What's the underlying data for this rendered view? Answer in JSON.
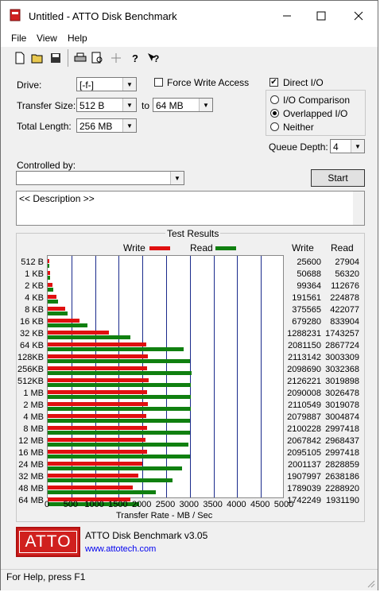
{
  "window": {
    "title": "Untitled - ATTO Disk Benchmark"
  },
  "menu": [
    "File",
    "View",
    "Help"
  ],
  "toolbar_icons": [
    "new-icon",
    "open-icon",
    "save-icon",
    "print-icon",
    "print-preview-icon",
    "move-icon",
    "help-icon",
    "context-help-icon"
  ],
  "settings": {
    "drive_label": "Drive:",
    "drive_value": "[-f-]",
    "force_write_label": "Force Write Access",
    "direct_io_label": "Direct I/O",
    "transfer_size_label": "Transfer Size:",
    "transfer_from": "512 B",
    "to_label": "to",
    "transfer_to": "64 MB",
    "total_length_label": "Total Length:",
    "total_length_value": "256 MB",
    "io_comparison_label": "I/O Comparison",
    "overlapped_io_label": "Overlapped I/O",
    "neither_label": "Neither",
    "queue_depth_label": "Queue Depth:",
    "queue_depth_value": "4",
    "controlled_by_label": "Controlled by:",
    "controlled_by_value": "",
    "start_label": "Start",
    "description": "<< Description >>"
  },
  "results": {
    "header": "Test Results",
    "write_legend": "Write",
    "read_legend": "Read",
    "write_col": "Write",
    "read_col": "Read",
    "x_axis_label": "Transfer Rate - MB / Sec",
    "x_ticks": [
      "0",
      "500",
      "1000",
      "1500",
      "2000",
      "2500",
      "3000",
      "3500",
      "4000",
      "4500",
      "5000"
    ]
  },
  "chart_data": {
    "type": "bar",
    "orientation": "horizontal",
    "xlabel": "Transfer Rate - MB / Sec",
    "xlim": [
      0,
      5000
    ],
    "categories": [
      "512 B",
      "1 KB",
      "2 KB",
      "4 KB",
      "8 KB",
      "16 KB",
      "32 KB",
      "64 KB",
      "128KB",
      "256KB",
      "512KB",
      "1 MB",
      "2 MB",
      "4 MB",
      "8 MB",
      "12 MB",
      "16 MB",
      "24 MB",
      "32 MB",
      "48 MB",
      "64 MB"
    ],
    "series": [
      {
        "name": "Write",
        "color": "#e01010",
        "values": [
          25.6,
          50.7,
          99.4,
          191.6,
          375.6,
          679.3,
          1288.2,
          2081.2,
          2113.1,
          2098.7,
          2126.2,
          2090.0,
          2110.5,
          2079.9,
          2100.2,
          2067.8,
          2095.1,
          2001.1,
          1908.0,
          1789.0,
          1742.2
        ]
      },
      {
        "name": "Read",
        "color": "#108010",
        "values": [
          27.9,
          56.3,
          112.7,
          224.9,
          422.1,
          833.9,
          1743.3,
          2867.7,
          3003.3,
          3032.4,
          3019.9,
          3026.5,
          3019.1,
          3004.9,
          2997.4,
          2968.4,
          2997.4,
          2828.9,
          2638.2,
          2288.9,
          1931.2
        ]
      }
    ],
    "write_text": [
      "25600",
      "50688",
      "99364",
      "191561",
      "375565",
      "679280",
      "1288231",
      "2081150",
      "2113142",
      "2098690",
      "2126221",
      "2090008",
      "2110549",
      "2079887",
      "2100228",
      "2067842",
      "2095105",
      "2001137",
      "1907997",
      "1789039",
      "1742249"
    ],
    "read_text": [
      "27904",
      "56320",
      "112676",
      "224878",
      "422077",
      "833904",
      "1743257",
      "2867724",
      "3003309",
      "3032368",
      "3019898",
      "3026478",
      "3019078",
      "3004874",
      "2997418",
      "2968437",
      "2997418",
      "2828859",
      "2638186",
      "2288920",
      "1931190"
    ]
  },
  "footer": {
    "logo": "ATTO",
    "app_name": "ATTO Disk Benchmark v3.05",
    "url": "www.attotech.com"
  },
  "status": "For Help, press F1"
}
